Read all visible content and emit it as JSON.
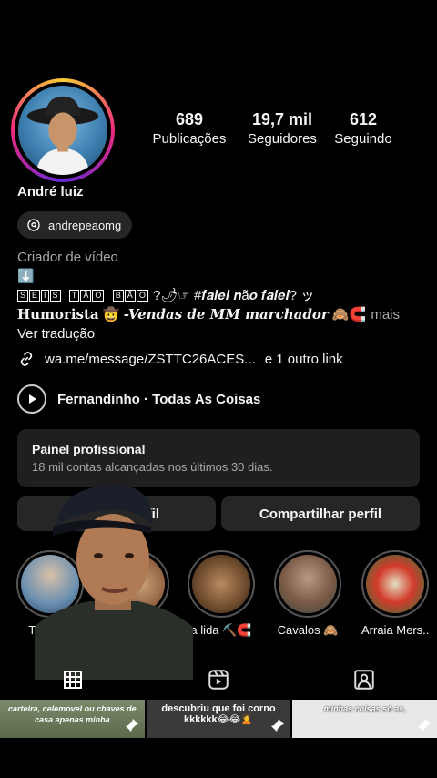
{
  "profile": {
    "name": "André luiz",
    "threads_handle": "andrepeaomg",
    "stats": [
      {
        "value": "689",
        "label": "Publicações"
      },
      {
        "value": "19,7 mil",
        "label": "Seguidores"
      },
      {
        "value": "612",
        "label": "Seguindo"
      }
    ]
  },
  "bio": {
    "category": "Criador de vídeo",
    "arrow": "⬇️",
    "line2_boxed": [
      "S",
      "E",
      "I",
      "S"
    ],
    "line2_boxed2": [
      "T",
      "Ã",
      "O"
    ],
    "line2_boxed3": [
      "B",
      "Ã",
      "O"
    ],
    "line2_tail": "?🌶☞ #𝒇𝒂𝒍𝒆𝒊 𝒏ã𝒐 𝒇𝒂𝒍𝒆𝒊? ッ",
    "line3_start": "Humorista",
    "line3_emoji": "🤠",
    "line3_italic": "-Vendas de MM marchador",
    "line3_emojis": "🙈🧲",
    "more": "mais",
    "translate": "Ver tradução"
  },
  "links": {
    "url": "wa.me/message/ZSTTC26ACES...",
    "extra": "e 1 outro link"
  },
  "music": {
    "text": "Fernandinho · Todas As Coisas"
  },
  "panel": {
    "title": "Painel profissional",
    "subtitle": "18 mil contas alcançadas nos últimos 30 dias."
  },
  "buttons": {
    "edit": "fil",
    "share": "Compartilhar perfil"
  },
  "highlights": [
    {
      "label": "Tião bru"
    },
    {
      "label": ""
    },
    {
      "label": "a lida ⛏️🧲"
    },
    {
      "label": "Cavalos 🙈"
    },
    {
      "label": "Arraia Mers..."
    }
  ],
  "grid": [
    {
      "caption": "carteira, celemovel ou chaves de casa apenas minha"
    },
    {
      "caption": "descubriu que foi corno kkkkkk😂😂🙎"
    },
    {
      "caption": "minhas coisas só as,"
    }
  ],
  "colors": {
    "background": "#000000",
    "card": "#262626",
    "muted": "#a8a8a8"
  }
}
